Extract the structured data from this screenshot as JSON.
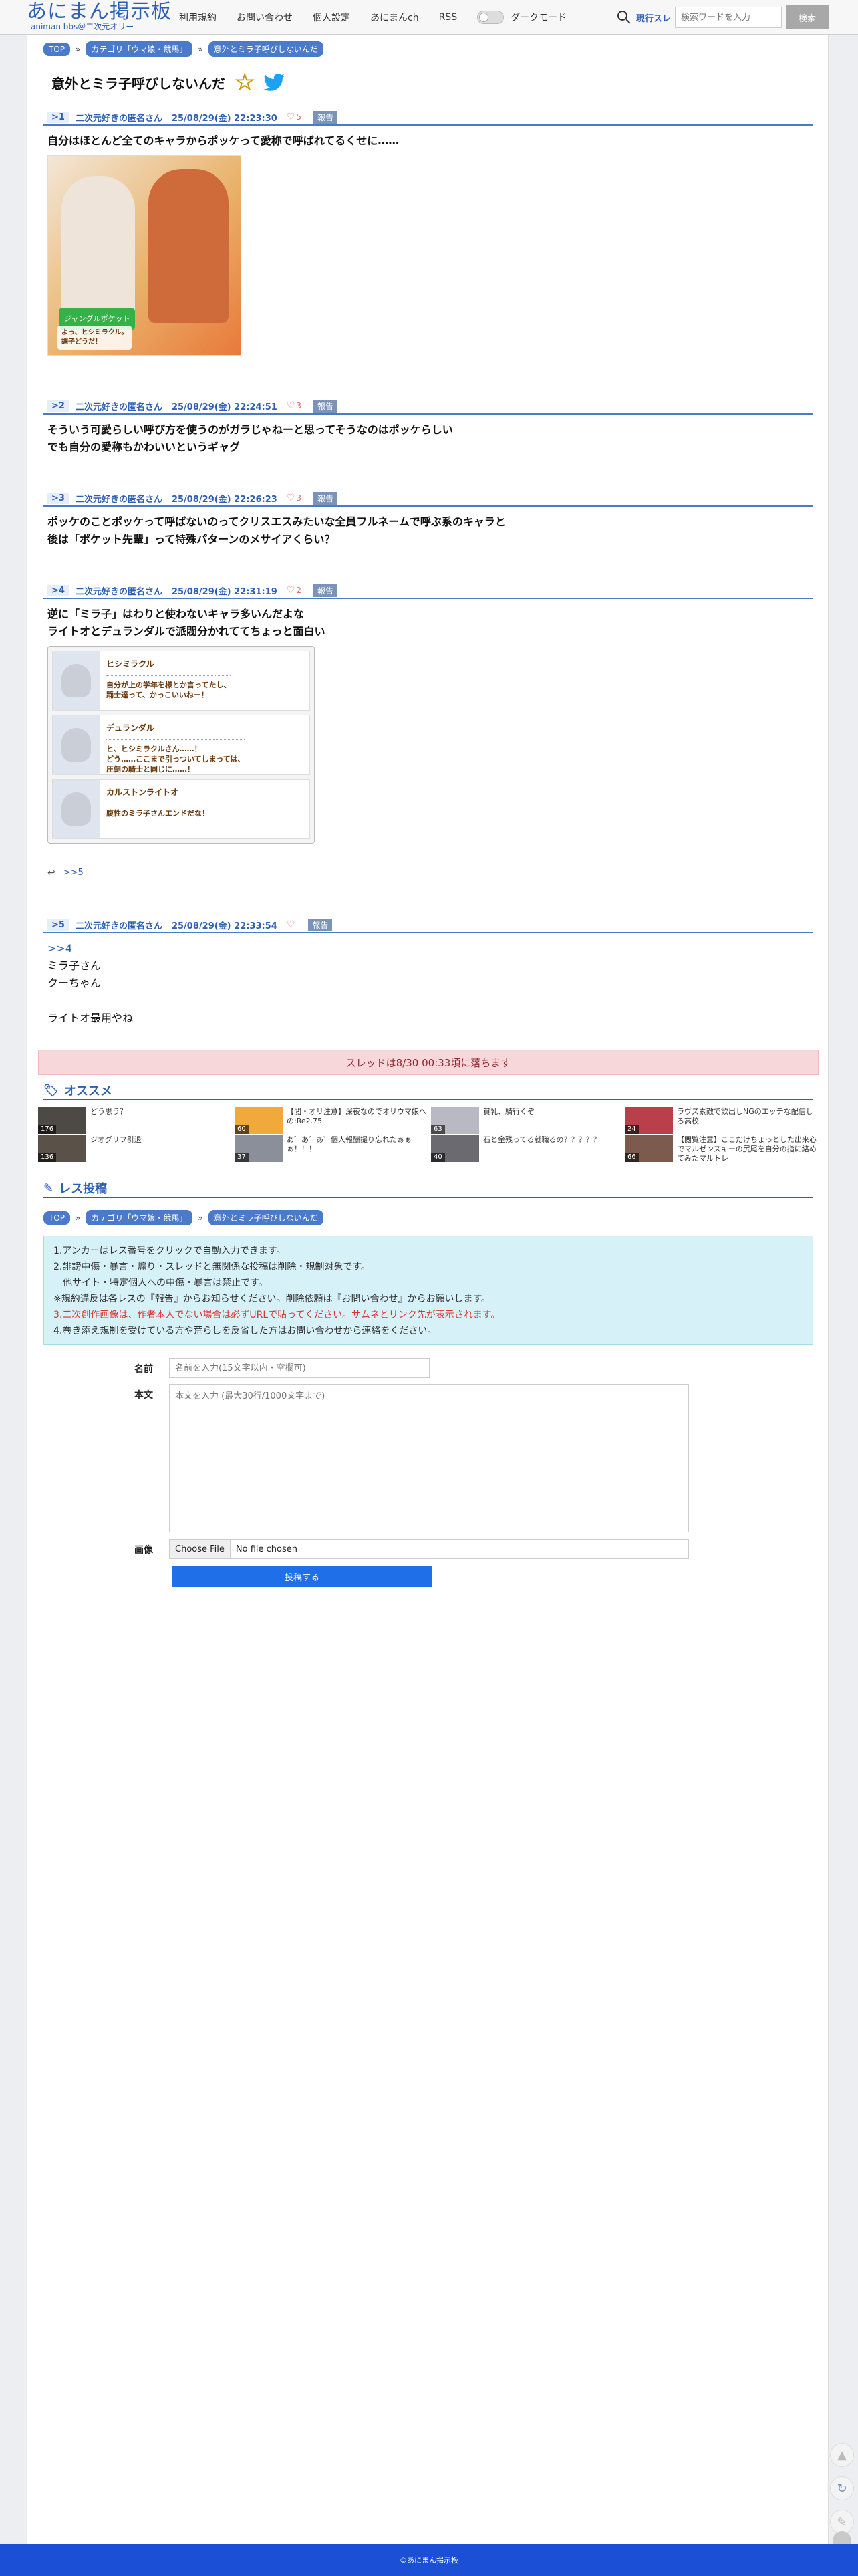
{
  "header": {
    "logo_title": "あにまん掲示板",
    "logo_sub": "animan bbs＠二次元オリー",
    "nav": [
      "利用規約",
      "お問い合わせ",
      "個人設定",
      "あにまんch",
      "RSS"
    ],
    "dark_mode_label": "ダークモード",
    "search_scope": "現行スレ",
    "search_placeholder": "検索ワードを入力",
    "search_button": "検索"
  },
  "breadcrumb": [
    "TOP",
    "カテゴリ「ウマ娘・競馬」",
    "意外とミラ子呼びしないんだ"
  ],
  "thread_title": "意外とミラ子呼びしないんだ",
  "posts": [
    {
      "num": ">1",
      "name": "二次元好きの匿名さん",
      "date": "25/08/29(金) 22:23:30",
      "likes": "5",
      "report": "報告",
      "lines": [
        "自分はほとんど全てのキャラからポッケって愛称で呼ばれてるくせに……"
      ],
      "image_tag": "ジャングルポケット",
      "image_caption": [
        "よっ、ヒシミラクル。",
        "調子どうだ！"
      ]
    },
    {
      "num": ">2",
      "name": "二次元好きの匿名さん",
      "date": "25/08/29(金) 22:24:51",
      "likes": "3",
      "report": "報告",
      "lines": [
        "そういう可愛らしい呼び方を使うのがガラじゃねーと思ってそうなのはポッケらしい",
        "でも自分の愛称もかわいいというギャグ"
      ]
    },
    {
      "num": ">3",
      "name": "二次元好きの匿名さん",
      "date": "25/08/29(金) 22:26:23",
      "likes": "3",
      "report": "報告",
      "lines": [
        "ポッケのことポッケって呼ばないのってクリスエスみたいな全員フルネームで呼ぶ系のキャラと",
        "後は「ポケット先輩」って特殊パターンのメサイアくらい？"
      ]
    },
    {
      "num": ">4",
      "name": "二次元好きの匿名さん",
      "date": "25/08/29(金) 22:31:19",
      "likes": "2",
      "report": "報告",
      "lines": [
        "逆に「ミラ子」はわりと使わないキャラ多いんだよな",
        "ライトオとデュランダルで派閥分かれててちょっと面白い"
      ],
      "dialog": [
        {
          "name": "ヒシミラクル",
          "lines": [
            "自分が上の学年を様とか言ってたし、",
            "踊士達って、かっこいいねー！"
          ]
        },
        {
          "name": "デュランダル",
          "lines": [
            "ヒ、ヒシミラクルさん……！",
            "どう……ここまで引っついてしまっては、",
            "圧倒の騎士と同じに……！"
          ]
        },
        {
          "name": "カルストンライトオ",
          "lines": [
            "腹性のミラ子さんエンドだな！"
          ]
        }
      ],
      "reply_link": ">>5"
    },
    {
      "num": ">5",
      "name": "二次元好きの匿名さん",
      "date": "25/08/29(金) 22:33:54",
      "likes": "",
      "report": "報告",
      "anchor": ">>4",
      "lines": [
        "ミラ子さん",
        "クーちゃん",
        "",
        "ライトオ最用やね"
      ]
    }
  ],
  "expire_notice": "スレッドは8/30 00:33頃に落ちます",
  "recommend": {
    "title": "オススメ",
    "items": [
      {
        "count": "176",
        "title": "どう思う？",
        "color": "#4d4a45"
      },
      {
        "count": "60",
        "title": "【閲・オリ注意】深夜なのでオリウマ娘への:Re2.75",
        "color": "#f2a93b"
      },
      {
        "count": "63",
        "title": "貧乳、騎行くぞ",
        "color": "#b9b9c3"
      },
      {
        "count": "24",
        "title": "ラヴズ素敵で飲出しNGのエッチな配信しろ高校",
        "color": "#b9404a"
      },
      {
        "count": "136",
        "title": "ジオグリフ引退",
        "color": "#5a5248"
      },
      {
        "count": "37",
        "title": "あ゛あ゛あ゛個人報酬撮り忘れたぁぁぁ！！！",
        "color": "#8a8f99"
      },
      {
        "count": "40",
        "title": "石と金残ってる就職るの？？？？？",
        "color": "#6b6a70"
      },
      {
        "count": "66",
        "title": "【閲覧注意】ここだけちょっとした出来心でマルゼンスキーの尻尾を自分の指に絡めてみたマルトレ",
        "color": "#7d5a4e"
      }
    ]
  },
  "form": {
    "title": "レス投稿",
    "info": [
      "1.アンカーはレス番号をクリックで自動入力できます。",
      "2.誹謗中傷・暴言・煽り・スレッドと無関係な投稿は削除・規制対象です。",
      "　他サイト・特定個人への中傷・暴言は禁止です。",
      "※規約違反は各レスの『報告』からお知らせください。削除依頼は『お問い合わせ』からお願いします。",
      "3.二次創作画像は、作者本人でない場合は必ずURLで貼ってください。サムネとリンク先が表示されます。",
      "4.巻き添え規制を受けている方や荒らしを反省した方はお問い合わせから連絡をください。"
    ],
    "name_label": "名前",
    "name_placeholder": "名前を入力(15文字以内・空欄可)",
    "body_label": "本文",
    "body_placeholder": "本文を入力 (最大30行/1000文字まで)",
    "image_label": "画像",
    "file_button": "Choose File",
    "file_status": "No file chosen",
    "submit": "投稿する"
  },
  "footer": "©あにまん掲示板",
  "colors": {
    "accent": "#2d5fb3",
    "footer": "#1a4fd6",
    "submit": "#1e6fe8"
  }
}
